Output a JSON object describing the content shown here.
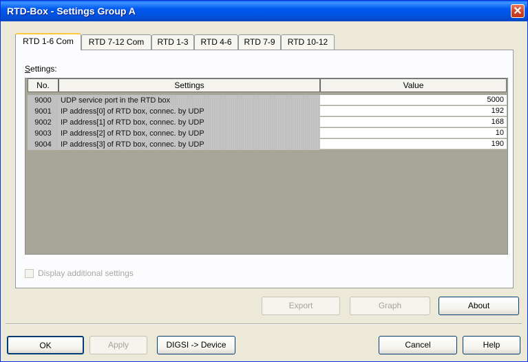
{
  "window": {
    "title": "RTD-Box - Settings Group A",
    "close_glyph": "✕"
  },
  "tabs": [
    {
      "label": "RTD 1-6 Com",
      "active": true
    },
    {
      "label": "RTD 7-12 Com",
      "active": false
    },
    {
      "label": "RTD 1-3",
      "active": false
    },
    {
      "label": "RTD 4-6",
      "active": false
    },
    {
      "label": "RTD 7-9",
      "active": false
    },
    {
      "label": "RTD 10-12",
      "active": false
    }
  ],
  "settings_label": {
    "mnemonic": "S",
    "rest": "ettings:"
  },
  "table": {
    "headers": {
      "no": "No.",
      "settings": "Settings",
      "value": "Value"
    },
    "rows": [
      {
        "no": "9000",
        "setting": "UDP service port in the RTD box",
        "value": "5000"
      },
      {
        "no": "9001",
        "setting": "IP address[0] of RTD box, connec. by UDP",
        "value": "192"
      },
      {
        "no": "9002",
        "setting": "IP address[1] of RTD box, connec. by UDP",
        "value": "168"
      },
      {
        "no": "9003",
        "setting": "IP address[2] of RTD box, connec. by UDP",
        "value": "10"
      },
      {
        "no": "9004",
        "setting": "IP address[3] of RTD box, connec. by UDP",
        "value": "190"
      }
    ]
  },
  "display_additional": {
    "label": "Display additional settings",
    "checked": false,
    "enabled": false
  },
  "buttons": {
    "export": "Export",
    "graph": "Graph",
    "about": "About",
    "ok": "OK",
    "apply": "Apply",
    "digsi": "DIGSI -> Device",
    "cancel": "Cancel",
    "help": "Help"
  }
}
